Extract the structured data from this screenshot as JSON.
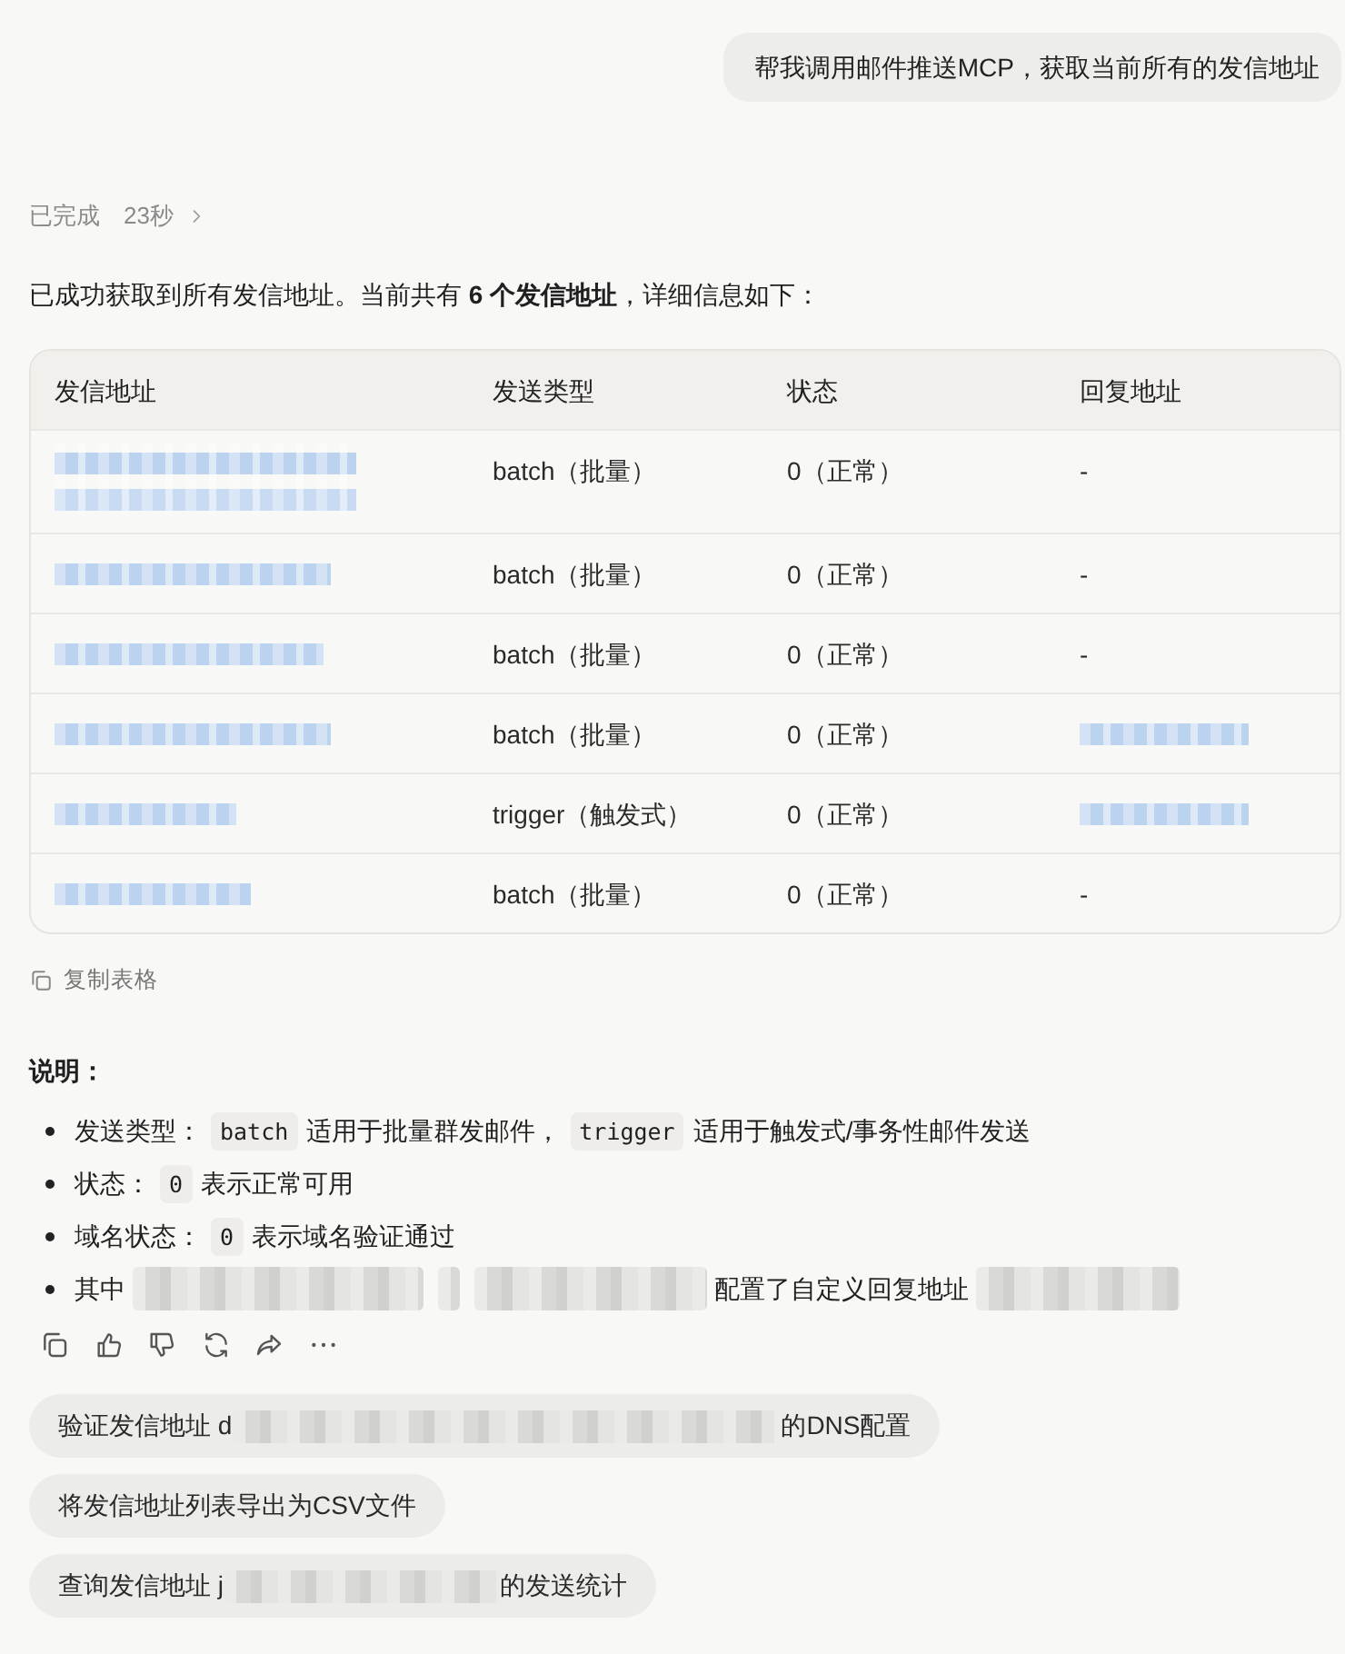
{
  "user_message": {
    "text": "帮我调用邮件推送MCP，获取当前所有的发信地址"
  },
  "status": {
    "label": "已完成",
    "duration": "23秒"
  },
  "intro": "已成功获取到所有发信地址。当前共有 **6 个发信地址**，详细信息如下：",
  "table": {
    "columns": [
      "发信地址",
      "发送类型",
      "状态",
      "回复地址"
    ],
    "rows": [
      {
        "cells": [
          {
            "kind": "redacted"
          },
          {
            "kind": "text",
            "text": "batch（批量）"
          },
          {
            "kind": "text",
            "text": "0（正常）"
          },
          {
            "kind": "text",
            "text": "-"
          }
        ]
      },
      {
        "cells": [
          {
            "kind": "redacted"
          },
          {
            "kind": "text",
            "text": "batch（批量）"
          },
          {
            "kind": "text",
            "text": "0（正常）"
          },
          {
            "kind": "text",
            "text": "-"
          }
        ]
      },
      {
        "cells": [
          {
            "kind": "redacted"
          },
          {
            "kind": "text",
            "text": "batch（批量）"
          },
          {
            "kind": "text",
            "text": "0（正常）"
          },
          {
            "kind": "text",
            "text": "-"
          }
        ]
      },
      {
        "cells": [
          {
            "kind": "redacted"
          },
          {
            "kind": "text",
            "text": "batch（批量）"
          },
          {
            "kind": "text",
            "text": "0（正常）"
          },
          {
            "kind": "redacted"
          }
        ]
      },
      {
        "cells": [
          {
            "kind": "redacted"
          },
          {
            "kind": "text",
            "text": "trigger（触发式）"
          },
          {
            "kind": "text",
            "text": "0（正常）"
          },
          {
            "kind": "redacted"
          }
        ]
      },
      {
        "cells": [
          {
            "kind": "redacted"
          },
          {
            "kind": "text",
            "text": "batch（批量）"
          },
          {
            "kind": "text",
            "text": "0（正常）"
          },
          {
            "kind": "text",
            "text": "-"
          }
        ]
      }
    ]
  },
  "copy_table": {
    "label": "复制表格"
  },
  "notes": {
    "title": "说明：",
    "items": [
      {
        "parts": [
          {
            "kind": "text",
            "text": "发送类型："
          },
          {
            "kind": "code",
            "text": "batch"
          },
          {
            "kind": "text",
            "text": "适用于批量群发邮件，"
          },
          {
            "kind": "code",
            "text": "trigger"
          },
          {
            "kind": "text",
            "text": "适用于触发式/事务性邮件发送"
          }
        ]
      },
      {
        "parts": [
          {
            "kind": "text",
            "text": "状态："
          },
          {
            "kind": "code",
            "text": "0"
          },
          {
            "kind": "text",
            "text": "表示正常可用"
          }
        ]
      },
      {
        "parts": [
          {
            "kind": "text",
            "text": "域名状态："
          },
          {
            "kind": "code",
            "text": "0"
          },
          {
            "kind": "text",
            "text": "表示域名验证通过"
          }
        ]
      },
      {
        "parts": [
          {
            "kind": "text",
            "text": "其中"
          },
          {
            "kind": "redacted"
          },
          {
            "kind": "redacted"
          },
          {
            "kind": "redacted"
          },
          {
            "kind": "text",
            "text": "配置了自定义回复地址"
          },
          {
            "kind": "redacted"
          }
        ]
      }
    ]
  },
  "actions": [
    {
      "kind": "copy"
    },
    {
      "kind": "like"
    },
    {
      "kind": "dislike"
    },
    {
      "kind": "regenerate"
    },
    {
      "kind": "share"
    },
    {
      "kind": "more"
    }
  ],
  "suggestions": [
    {
      "parts": [
        {
          "kind": "text",
          "text": "验证发信地址 d"
        },
        {
          "kind": "redacted"
        },
        {
          "kind": "text",
          "text": "的DNS配置"
        }
      ]
    },
    {
      "parts": [
        {
          "kind": "text",
          "text": "将发信地址列表导出为CSV文件"
        }
      ]
    },
    {
      "parts": [
        {
          "kind": "text",
          "text": "查询发信地址 j"
        },
        {
          "kind": "redacted"
        },
        {
          "kind": "text",
          "text": "的发送统计"
        }
      ]
    }
  ]
}
